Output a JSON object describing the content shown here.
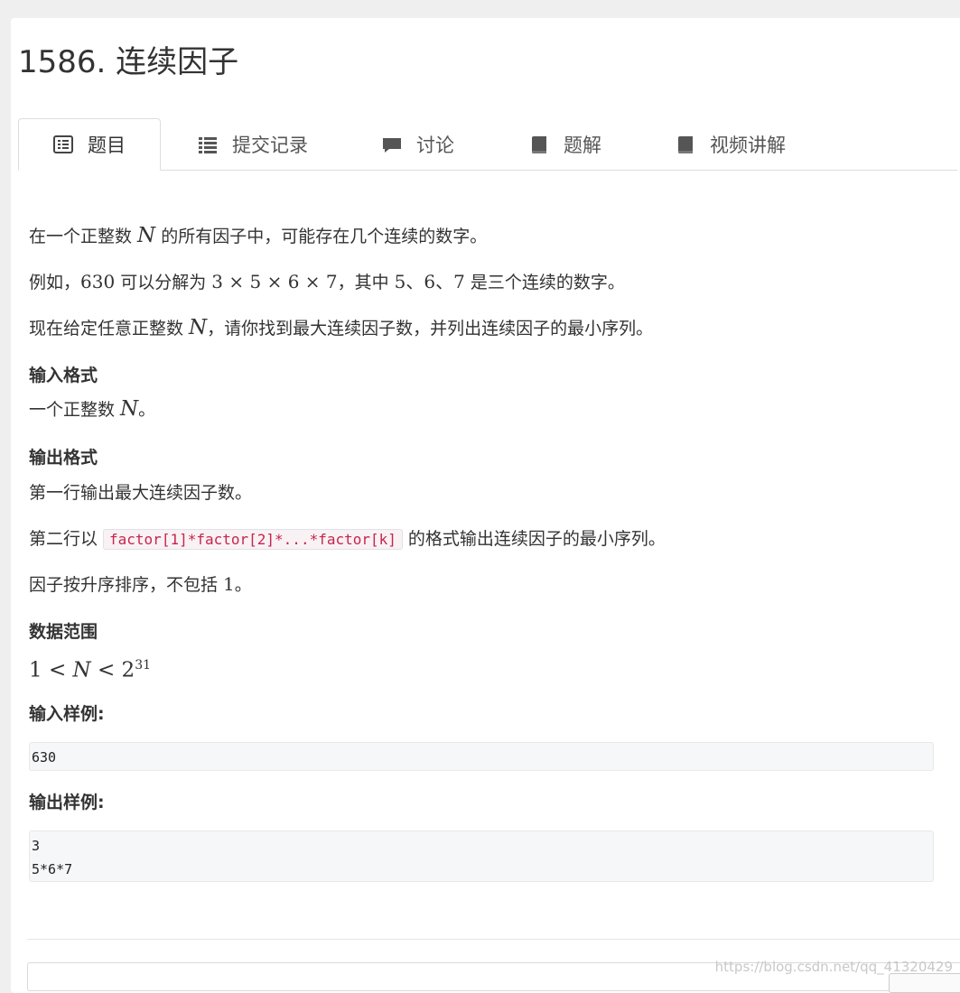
{
  "problem": {
    "title": "1586. 连续因子"
  },
  "tabs": [
    {
      "label": "题目",
      "icon": "list-alt-icon",
      "active": true
    },
    {
      "label": "提交记录",
      "icon": "list-icon",
      "active": false
    },
    {
      "label": "讨论",
      "icon": "comment-icon",
      "active": false
    },
    {
      "label": "题解",
      "icon": "book-icon",
      "active": false
    },
    {
      "label": "视频讲解",
      "icon": "book-icon",
      "active": false
    }
  ],
  "statement": {
    "line1_a": "在一个正整数 ",
    "line1_var": "N",
    "line1_b": " 的所有因子中，可能存在几个连续的数字。",
    "line2_a": "例如，",
    "line2_num": "630",
    "line2_b": " 可以分解为 ",
    "line2_expr": "3 × 5 × 6 × 7",
    "line2_c": "，其中 ",
    "line2_d": "5、6、7",
    "line2_e": " 是三个连续的数字。",
    "line3_a": "现在给定任意正整数 ",
    "line3_var": "N",
    "line3_b": "，请你找到最大连续因子数，并列出连续因子的最小序列。"
  },
  "input_format": {
    "heading": "输入格式",
    "text_a": "一个正整数 ",
    "text_var": "N",
    "text_b": "。"
  },
  "output_format": {
    "heading": "输出格式",
    "line1": "第一行输出最大连续因子数。",
    "line2_a": "第二行以",
    "line2_code": "factor[1]*factor[2]*...*factor[k]",
    "line2_b": "的格式输出连续因子的最小序列。",
    "line3_a": "因子按升序排序，不包括 ",
    "line3_num": "1",
    "line3_b": "。"
  },
  "data_range": {
    "heading": "数据范围",
    "expr_a": "1 < ",
    "expr_var": "N",
    "expr_b": " < 2",
    "expr_exp": "31"
  },
  "sample_input": {
    "heading": "输入样例:",
    "lines": [
      "630"
    ]
  },
  "sample_output": {
    "heading": "输出样例:",
    "lines": [
      "3",
      "5*6*7"
    ]
  },
  "watermark": "https://blog.csdn.net/qq_41320429"
}
